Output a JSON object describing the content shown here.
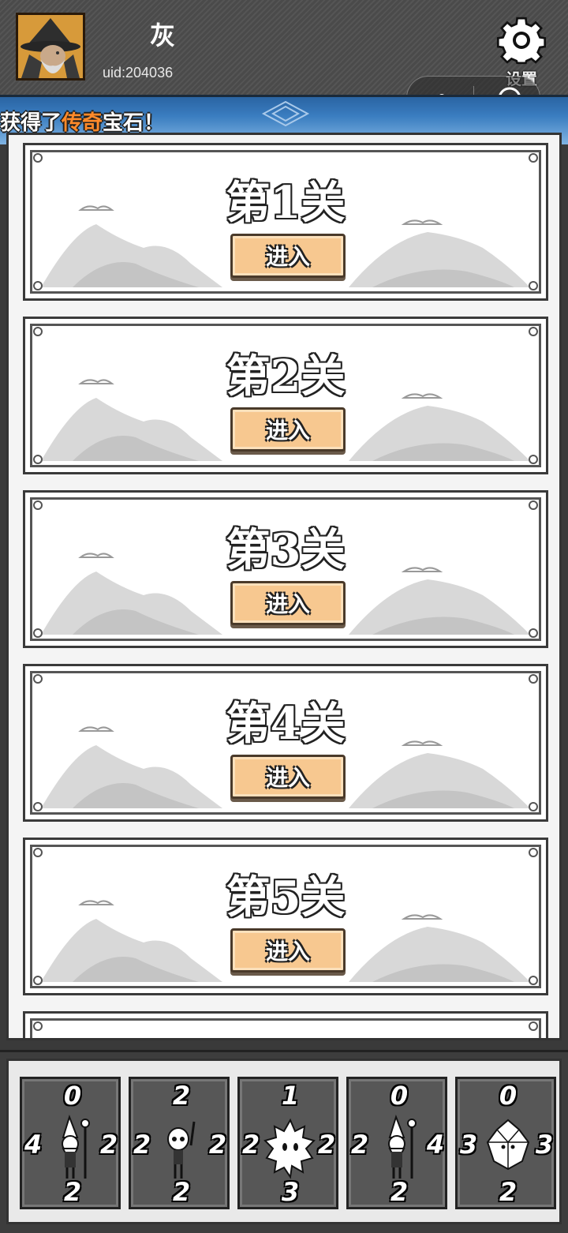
{
  "header": {
    "player_name": "灰",
    "uid": "uid:204036",
    "settings_label": "设置"
  },
  "banner": {
    "prefix": "获得了",
    "highlight": "传奇",
    "suffix": "宝石！",
    "highlight_color": "#ff8a2a"
  },
  "levels": [
    {
      "title": "第1关",
      "button": "进入"
    },
    {
      "title": "第2关",
      "button": "进入"
    },
    {
      "title": "第3关",
      "button": "进入"
    },
    {
      "title": "第4关",
      "button": "进入"
    },
    {
      "title": "第5关",
      "button": "进入"
    }
  ],
  "cards": [
    {
      "unit": "wizard-icon",
      "top": "0",
      "left": "4",
      "right": "2",
      "bottom": "2"
    },
    {
      "unit": "skeleton-icon",
      "top": "2",
      "left": "2",
      "right": "2",
      "bottom": "2"
    },
    {
      "unit": "spiky-blob-icon",
      "top": "1",
      "left": "2",
      "right": "2",
      "bottom": "3"
    },
    {
      "unit": "wizard-icon",
      "top": "0",
      "left": "2",
      "right": "4",
      "bottom": "2"
    },
    {
      "unit": "crystal-golem-icon",
      "top": "0",
      "left": "3",
      "right": "3",
      "bottom": "2"
    }
  ]
}
